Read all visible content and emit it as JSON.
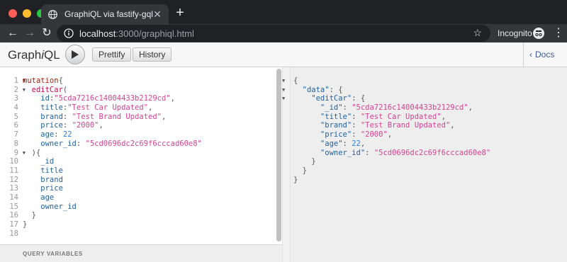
{
  "browser": {
    "tab_title": "GraphiQL via fastify-gql",
    "tab_close": "✕",
    "new_tab": "+",
    "url_host": "localhost",
    "url_rest": ":3000/graphiql.html",
    "incognito_label": "Incognito",
    "colors": {
      "close": "#ff5f57",
      "minimize": "#febc2e",
      "maximize": "#28c840"
    }
  },
  "graphiql": {
    "logo_prefix": "Graph",
    "logo_italic": "i",
    "logo_suffix": "QL",
    "prettify_label": "Prettify",
    "history_label": "History",
    "docs_label": "Docs",
    "query_variables_label": "QUERY VARIABLES"
  },
  "query": {
    "line_numbers": [
      "1",
      "2",
      "3",
      "4",
      "5",
      "6",
      "7",
      "8",
      "9",
      "10",
      "11",
      "12",
      "13",
      "14",
      "15",
      "16",
      "17",
      "18"
    ],
    "lines": [
      [
        {
          "t": "kw",
          "v": "mutation"
        },
        {
          "t": "pun",
          "v": "{"
        }
      ],
      [
        {
          "t": "def",
          "v": "  editCar"
        },
        {
          "t": "pun",
          "v": "("
        }
      ],
      [
        {
          "t": "prop",
          "v": "    id"
        },
        {
          "t": "pun",
          "v": ":"
        },
        {
          "t": "str",
          "v": "\"5cda7216c14004433b2129cd\""
        },
        {
          "t": "pun",
          "v": ","
        }
      ],
      [
        {
          "t": "prop",
          "v": "    title"
        },
        {
          "t": "pun",
          "v": ":"
        },
        {
          "t": "str",
          "v": "\"Test Car Updated\""
        },
        {
          "t": "pun",
          "v": ","
        }
      ],
      [
        {
          "t": "prop",
          "v": "    brand"
        },
        {
          "t": "pun",
          "v": ": "
        },
        {
          "t": "str",
          "v": "\"Test Brand Updated\""
        },
        {
          "t": "pun",
          "v": ","
        }
      ],
      [
        {
          "t": "prop",
          "v": "    price"
        },
        {
          "t": "pun",
          "v": ": "
        },
        {
          "t": "str",
          "v": "\"2000\""
        },
        {
          "t": "pun",
          "v": ","
        }
      ],
      [
        {
          "t": "prop",
          "v": "    age"
        },
        {
          "t": "pun",
          "v": ": "
        },
        {
          "t": "num",
          "v": "22"
        }
      ],
      [
        {
          "t": "prop",
          "v": "    owner_id"
        },
        {
          "t": "pun",
          "v": ": "
        },
        {
          "t": "str",
          "v": "\"5cd0696dc2c69f6cccad60e8\""
        }
      ],
      [
        {
          "t": "pun",
          "v": "  ){"
        }
      ],
      [
        {
          "t": "prop",
          "v": "    _id"
        }
      ],
      [
        {
          "t": "prop",
          "v": "    title"
        }
      ],
      [
        {
          "t": "prop",
          "v": "    brand"
        }
      ],
      [
        {
          "t": "prop",
          "v": "    price"
        }
      ],
      [
        {
          "t": "prop",
          "v": "    age"
        }
      ],
      [
        {
          "t": "prop",
          "v": "    owner_id"
        }
      ],
      [
        {
          "t": "pun",
          "v": "  }"
        }
      ],
      [
        {
          "t": "pun",
          "v": "}"
        }
      ],
      [
        {
          "t": "pun",
          "v": ""
        }
      ]
    ]
  },
  "result": {
    "lines": [
      [
        {
          "t": "pun",
          "v": "{"
        }
      ],
      [
        {
          "t": "key",
          "v": "  \"data\""
        },
        {
          "t": "pun",
          "v": ": {"
        }
      ],
      [
        {
          "t": "key",
          "v": "    \"editCar\""
        },
        {
          "t": "pun",
          "v": ": {"
        }
      ],
      [
        {
          "t": "key",
          "v": "      \"_id\""
        },
        {
          "t": "pun",
          "v": ": "
        },
        {
          "t": "str",
          "v": "\"5cda7216c14004433b2129cd\""
        },
        {
          "t": "pun",
          "v": ","
        }
      ],
      [
        {
          "t": "key",
          "v": "      \"title\""
        },
        {
          "t": "pun",
          "v": ": "
        },
        {
          "t": "str",
          "v": "\"Test Car Updated\""
        },
        {
          "t": "pun",
          "v": ","
        }
      ],
      [
        {
          "t": "key",
          "v": "      \"brand\""
        },
        {
          "t": "pun",
          "v": ": "
        },
        {
          "t": "str",
          "v": "\"Test Brand Updated\""
        },
        {
          "t": "pun",
          "v": ","
        }
      ],
      [
        {
          "t": "key",
          "v": "      \"price\""
        },
        {
          "t": "pun",
          "v": ": "
        },
        {
          "t": "str",
          "v": "\"2000\""
        },
        {
          "t": "pun",
          "v": ","
        }
      ],
      [
        {
          "t": "key",
          "v": "      \"age\""
        },
        {
          "t": "pun",
          "v": ": "
        },
        {
          "t": "num",
          "v": "22"
        },
        {
          "t": "pun",
          "v": ","
        }
      ],
      [
        {
          "t": "key",
          "v": "      \"owner_id\""
        },
        {
          "t": "pun",
          "v": ": "
        },
        {
          "t": "str",
          "v": "\"5cd0696dc2c69f6cccad60e8\""
        }
      ],
      [
        {
          "t": "pun",
          "v": "    }"
        }
      ],
      [
        {
          "t": "pun",
          "v": "  }"
        }
      ],
      [
        {
          "t": "pun",
          "v": "}"
        }
      ]
    ]
  }
}
